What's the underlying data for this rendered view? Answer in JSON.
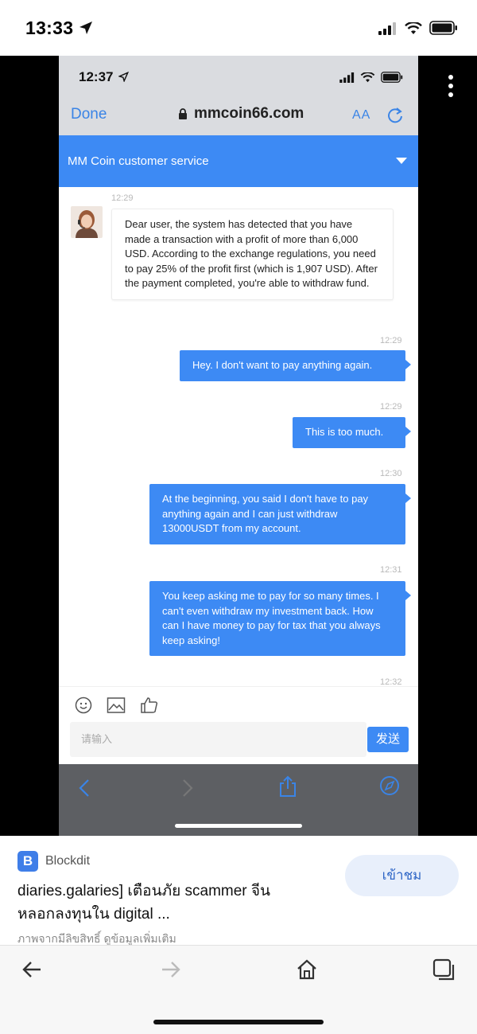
{
  "outer_status": {
    "time": "13:33"
  },
  "inner_status": {
    "time": "12:37"
  },
  "browser": {
    "done_label": "Done",
    "url": "mmcoin66.com",
    "text_size_label": "AA"
  },
  "chat_header": {
    "title": "MM Coin customer service"
  },
  "messages": [
    {
      "side": "in",
      "time": "12:29",
      "text": "Dear user, the system has detected that you have made a transaction with a profit of more than 6,000 USD. According to the exchange regulations, you need to pay 25% of the profit first (which is 1,907 USD). After the payment completed, you're able to withdraw fund."
    },
    {
      "side": "out",
      "time": "12:29",
      "text": "Hey. I don't want to pay anything again."
    },
    {
      "side": "out",
      "time": "12:29",
      "text": "This is too much."
    },
    {
      "side": "out",
      "time": "12:30",
      "text": "At the beginning, you said I don't have to pay anything again and I can just withdraw 13000USDT from my account."
    },
    {
      "side": "out",
      "time": "12:31",
      "text": "You keep asking me to pay for so many times. I can't even withdraw my investment back. How can I have money to pay for tax that you always keep asking!"
    },
    {
      "side": "out",
      "time": "12:32",
      "text": ""
    }
  ],
  "composer": {
    "placeholder": "请输入",
    "send_label": "发送"
  },
  "card": {
    "source_name": "Blockdit",
    "source_logo_letter": "B",
    "view_button": "เข้าชม",
    "headline_line1": "diaries.galaries] เตือนภัย scammer จีน",
    "headline_line2": "หลอกลงทุนใน digital ...",
    "subline": "ภาพจากมีลิขสิทธิ์ ดูข้อมูลเพิ่มเติม"
  },
  "colors": {
    "accent": "#3d8af4",
    "link_blue": "#3a84e6",
    "view_button_bg": "#e8effb"
  }
}
